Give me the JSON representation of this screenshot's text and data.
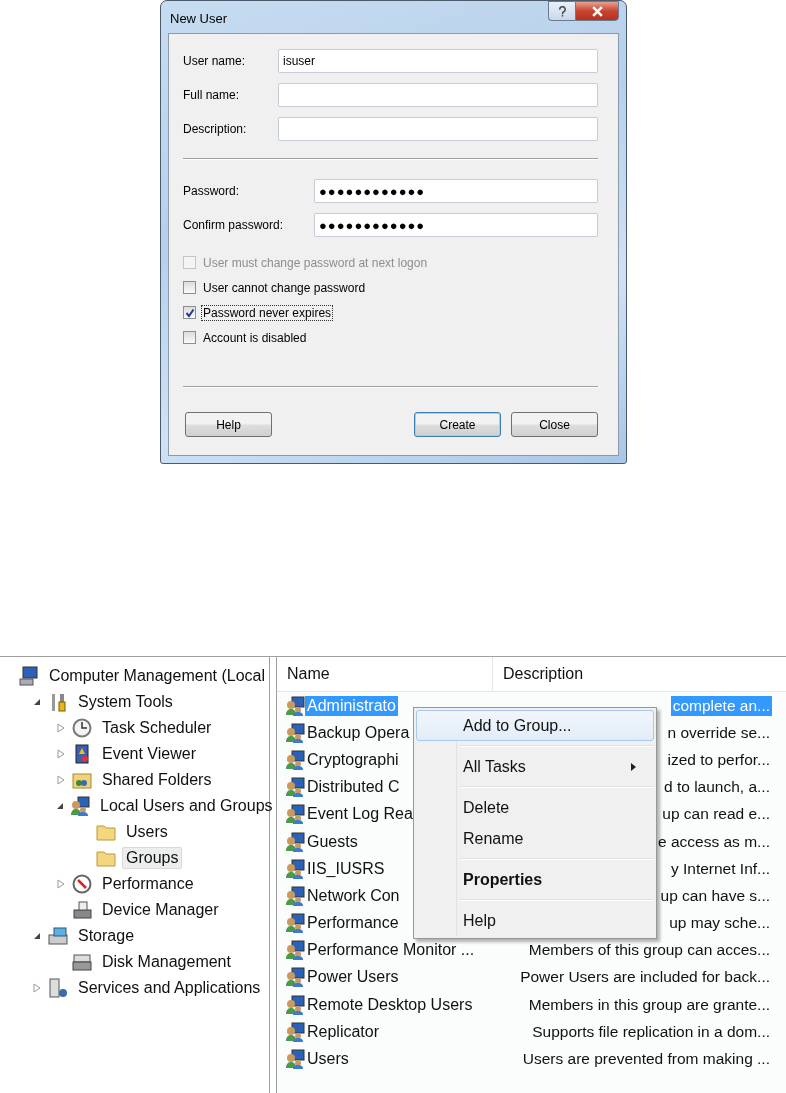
{
  "dialog": {
    "title": "New User",
    "title_buttons": [
      {
        "kind": "help"
      },
      {
        "kind": "close"
      }
    ],
    "fields": [
      {
        "label": "User name:",
        "value": "isuser",
        "kind": "wide"
      },
      {
        "label": "Full name:",
        "kind": "wide"
      },
      {
        "label": "Description:",
        "kind": "wide"
      },
      {
        "label": "Password:",
        "value": "●●●●●●●●●●●●",
        "kind": "narrow"
      },
      {
        "label": "Confirm password:",
        "value": "●●●●●●●●●●●●",
        "kind": "narrow"
      }
    ],
    "checkboxes": [
      {
        "label": "User must change password at next logon",
        "checked": false,
        "disabled": true,
        "focused": false
      },
      {
        "label": "User cannot change password",
        "checked": false,
        "disabled": false,
        "focused": false
      },
      {
        "label": "Password never expires",
        "checked": true,
        "disabled": false,
        "focused": true
      },
      {
        "label": "Account is disabled",
        "checked": false,
        "disabled": false,
        "focused": false
      }
    ],
    "buttons": [
      {
        "label": "Help",
        "default": false
      },
      {
        "label": "Create",
        "default": true
      },
      {
        "label": "Close",
        "default": false
      }
    ]
  },
  "tree": {
    "items": [
      {
        "label": "Computer Management (Local",
        "selected": false,
        "children": [
          {
            "label": "System Tools",
            "expanded": true,
            "selected": false,
            "children": [
              {
                "label": "Task Scheduler",
                "expanded": false,
                "selected": false
              },
              {
                "label": "Event Viewer",
                "expanded": false,
                "selected": false
              },
              {
                "label": "Shared Folders",
                "expanded": false,
                "selected": false
              },
              {
                "label": "Local Users and Groups",
                "expanded": true,
                "selected": false,
                "children": [
                  {
                    "label": "Users",
                    "selected": false
                  },
                  {
                    "label": "Groups",
                    "selected": true
                  }
                ]
              },
              {
                "label": "Performance",
                "expanded": false,
                "selected": false
              },
              {
                "label": "Device Manager",
                "selected": false
              }
            ]
          },
          {
            "label": "Storage",
            "expanded": true,
            "selected": false,
            "children": [
              {
                "label": "Disk Management",
                "selected": false
              }
            ]
          },
          {
            "label": "Services and Applications",
            "expanded": false,
            "selected": false
          }
        ]
      }
    ]
  },
  "table": {
    "columns": [
      "Name",
      "Description"
    ],
    "rows": [
      {
        "name": "Administrato",
        "description": "complete an...",
        "selected": true
      },
      {
        "name": "Backup Opera",
        "description": "n override se...",
        "selected": false
      },
      {
        "name": "Cryptographi",
        "description": "ized to perfor...",
        "selected": false
      },
      {
        "name": "Distributed C",
        "description": "d to launch, a...",
        "selected": false
      },
      {
        "name": "Event Log Rea",
        "description": "up can read e...",
        "selected": false
      },
      {
        "name": "Guests",
        "description": "e access as m...",
        "selected": false
      },
      {
        "name": "IIS_IUSRS",
        "description": "y Internet Inf...",
        "selected": false
      },
      {
        "name": "Network Con",
        "description": "up can have s...",
        "selected": false
      },
      {
        "name": "Performance",
        "description": "up may sche...",
        "selected": false
      },
      {
        "name": "Performance Monitor ...",
        "description": "Members of this group can acces...",
        "selected": false
      },
      {
        "name": "Power Users",
        "description": "Power Users are included for back...",
        "selected": false
      },
      {
        "name": "Remote Desktop Users",
        "description": "Members in this group are grante...",
        "selected": false
      },
      {
        "name": "Replicator",
        "description": "Supports file replication in a dom...",
        "selected": false
      },
      {
        "name": "Users",
        "description": "Users are prevented from making ...",
        "selected": false
      }
    ]
  },
  "context_menu": {
    "groups": [
      [
        {
          "label": "Add to Group...",
          "selected": true,
          "submenu": false,
          "default": false
        }
      ],
      [
        {
          "label": "All Tasks",
          "selected": false,
          "submenu": true,
          "default": false
        }
      ],
      [
        {
          "label": "Delete",
          "selected": false,
          "submenu": false,
          "default": false
        },
        {
          "label": "Rename",
          "selected": false,
          "submenu": false,
          "default": false
        }
      ],
      [
        {
          "label": "Properties",
          "selected": false,
          "submenu": false,
          "default": true
        }
      ],
      [
        {
          "label": "Help",
          "selected": false,
          "submenu": false,
          "default": false
        }
      ]
    ]
  }
}
